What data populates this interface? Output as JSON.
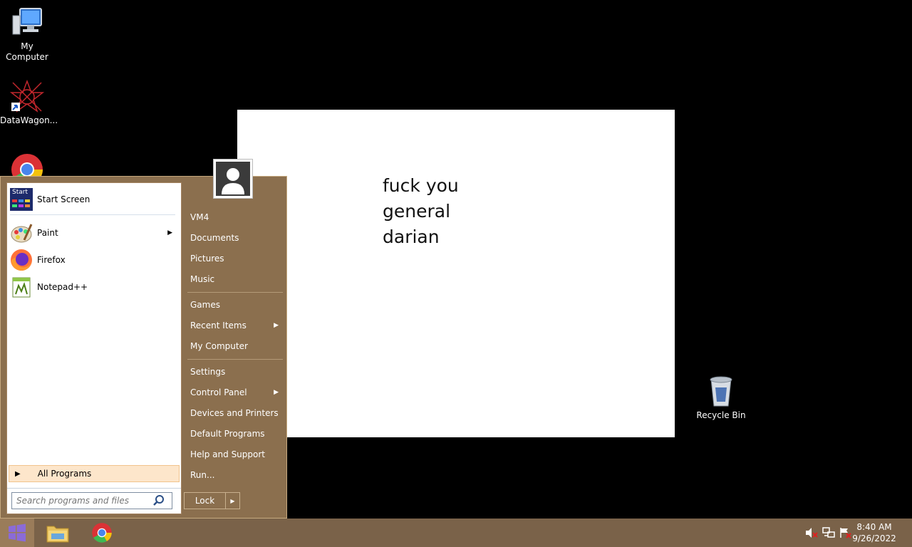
{
  "desktop": {
    "icons": [
      {
        "label": "My\nComputer"
      },
      {
        "label": "DataWagon..."
      },
      {
        "label": "Recycle Bin"
      }
    ],
    "note_lines": [
      "fuck you",
      "general",
      "darian"
    ]
  },
  "start_menu": {
    "pinned": [
      {
        "label": "Start Screen",
        "icon": "start-screen-icon",
        "badge": "Start"
      },
      {
        "label": "Paint",
        "icon": "paint-icon",
        "has_submenu": true
      },
      {
        "label": "Firefox",
        "icon": "firefox-icon"
      },
      {
        "label": "Notepad++",
        "icon": "notepadpp-icon"
      }
    ],
    "all_programs": "All Programs",
    "search_placeholder": "Search programs and files",
    "right_items": [
      {
        "label": "VM4"
      },
      {
        "label": "Documents"
      },
      {
        "label": "Pictures"
      },
      {
        "label": "Music"
      },
      {
        "label": "Games"
      },
      {
        "label": "Recent Items",
        "has_submenu": true
      },
      {
        "label": "My Computer"
      },
      {
        "label": "Settings"
      },
      {
        "label": "Control Panel",
        "has_submenu": true
      },
      {
        "label": "Devices and Printers"
      },
      {
        "label": "Default Programs"
      },
      {
        "label": "Help and Support"
      },
      {
        "label": "Run..."
      }
    ],
    "lock_label": "Lock"
  },
  "taskbar": {
    "pinned": [
      "file-explorer-icon",
      "chrome-icon"
    ],
    "tray": [
      "volume-muted-icon",
      "network-icon",
      "action-center-icon"
    ],
    "time": "8:40 AM",
    "date": "9/26/2022"
  },
  "colors": {
    "start_menu_bg": "#8b6f4e",
    "taskbar_bg": "#7a6249",
    "all_programs_bg": "#fde6cb"
  }
}
